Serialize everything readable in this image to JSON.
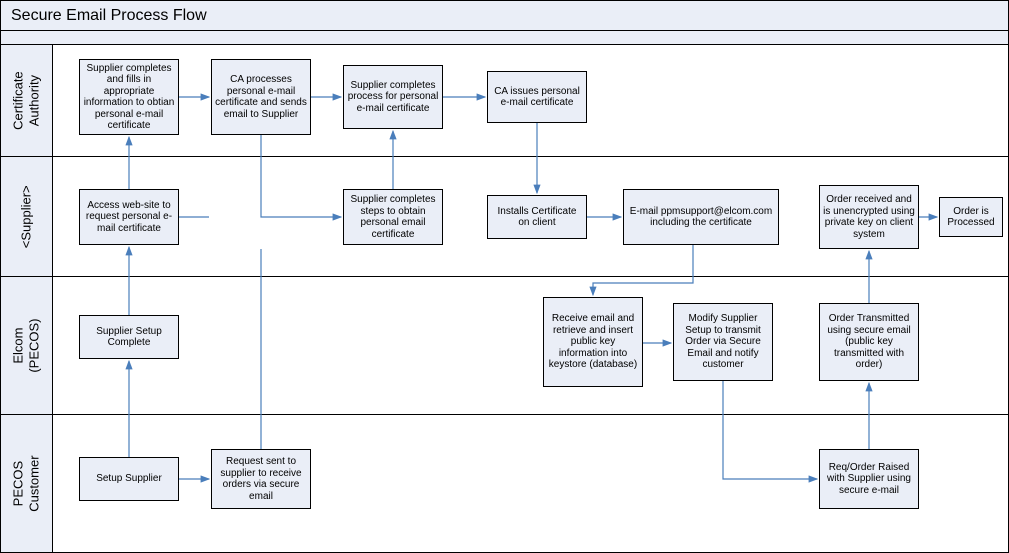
{
  "title": "Secure Email Process Flow",
  "lanes": {
    "ca": {
      "label": "Certificate\nAuthority"
    },
    "supplier": {
      "label": "<Supplier>"
    },
    "elcom": {
      "label": "Elcom\n(PECOS)"
    },
    "customer": {
      "label": "PECOS\nCustomer"
    }
  },
  "boxes": {
    "ca1": "Supplier completes and fills in appropriate information to obtian personal e-mail certificate",
    "ca2": "CA processes personal e-mail certificate and sends email to Supplier",
    "ca3": "Supplier completes process for personal e-mail certificate",
    "ca4": "CA issues personal e-mail certificate",
    "sup1": "Access web-site to request personal e-mail certificate",
    "sup2": "Supplier completes steps to obtain personal email certificate",
    "sup3": "Installs Certificate on client",
    "sup4": "E-mail ppmsupport@elcom.com including the certificate",
    "sup5": "Order received and is unencrypted using private key on client system",
    "sup6": "Order is Processed",
    "elc1": "Supplier Setup Complete",
    "elc2": "Receive email and retrieve and insert public key information into keystore (database)",
    "elc3": "Modify Supplier Setup to transmit Order via Secure Email and notify customer",
    "elc4": "Order Transmitted using secure email (public key transmitted with order)",
    "cus1": "Setup Supplier",
    "cus2": "Request sent to supplier to receive orders via secure email",
    "cus3": "Req/Order Raised with Supplier using secure e-mail"
  }
}
